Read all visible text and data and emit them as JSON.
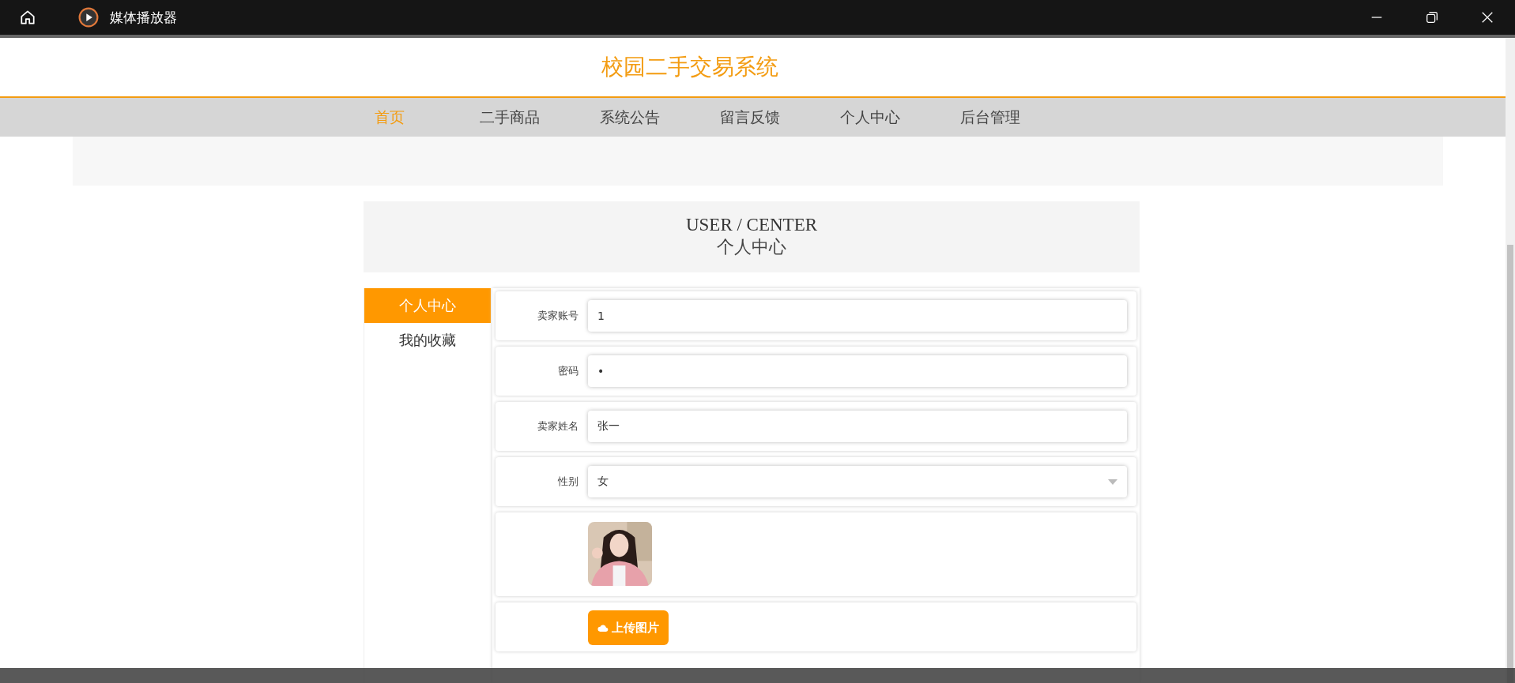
{
  "window": {
    "title": "媒体播放器"
  },
  "site_title": "校园二手交易系统",
  "nav": [
    {
      "label": "首页",
      "selected": true
    },
    {
      "label": "二手商品",
      "selected": false
    },
    {
      "label": "系统公告",
      "selected": false
    },
    {
      "label": "留言反馈",
      "selected": false
    },
    {
      "label": "个人中心",
      "selected": false
    },
    {
      "label": "后台管理",
      "selected": false
    }
  ],
  "section": {
    "title_en": "USER / CENTER",
    "title": "个人中心"
  },
  "sidebar": {
    "items": [
      {
        "label": "个人中心",
        "selected": true
      },
      {
        "label": "我的收藏",
        "selected": false
      }
    ]
  },
  "form": {
    "fields": [
      {
        "kind": "text",
        "label": "卖家账号",
        "value": "1"
      },
      {
        "kind": "text",
        "label": "密码",
        "value": "•"
      },
      {
        "kind": "text",
        "label": "卖家姓名",
        "value": "张一"
      },
      {
        "kind": "select",
        "label": "性别",
        "value": "女"
      },
      {
        "kind": "picture"
      },
      {
        "kind": "upload",
        "button": "上传图片"
      }
    ]
  }
}
